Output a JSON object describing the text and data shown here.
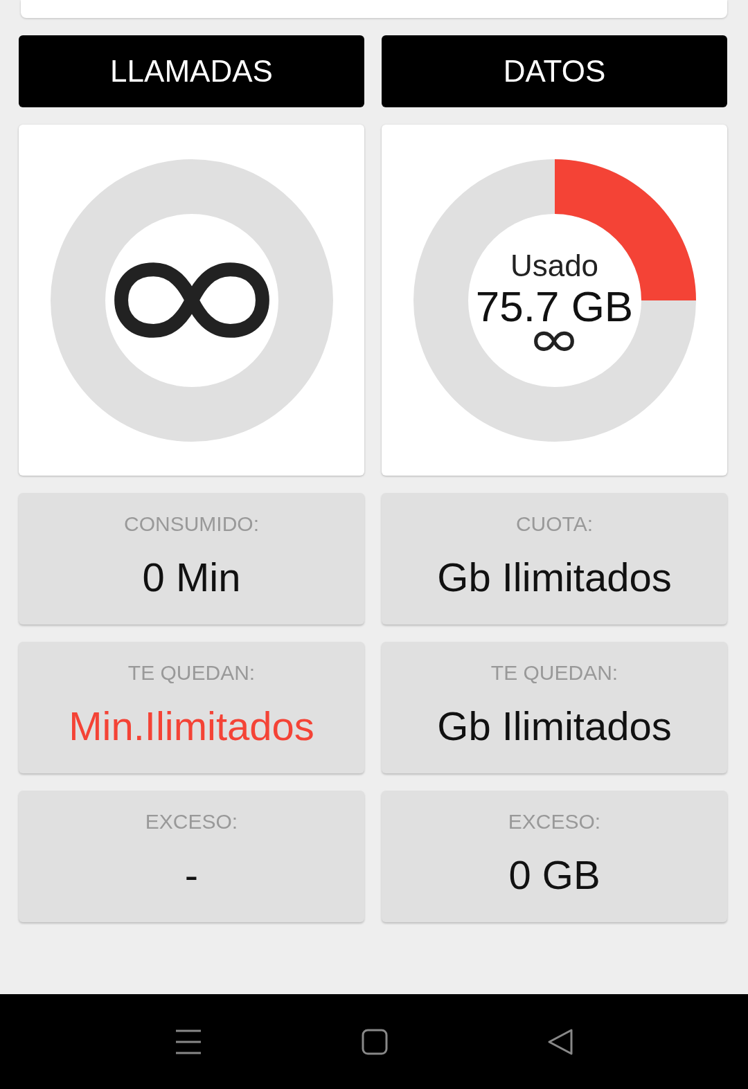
{
  "columns": [
    {
      "header": "LLAMADAS",
      "gauge": {
        "kind": "infinite"
      },
      "stats": [
        {
          "label": "CONSUMIDO:",
          "value": "0 Min",
          "alert": false
        },
        {
          "label": "TE QUEDAN:",
          "value": "Min.Ilimitados",
          "alert": true
        },
        {
          "label": "EXCESO:",
          "value": "-",
          "alert": false
        }
      ]
    },
    {
      "header": "DATOS",
      "gauge": {
        "kind": "usage",
        "title": "Usado",
        "amount": "75.7 GB"
      },
      "stats": [
        {
          "label": "CUOTA:",
          "value": "Gb Ilimitados",
          "alert": false
        },
        {
          "label": "TE QUEDAN:",
          "value": "Gb Ilimitados",
          "alert": false
        },
        {
          "label": "EXCESO:",
          "value": "0 GB",
          "alert": false
        }
      ]
    }
  ]
}
